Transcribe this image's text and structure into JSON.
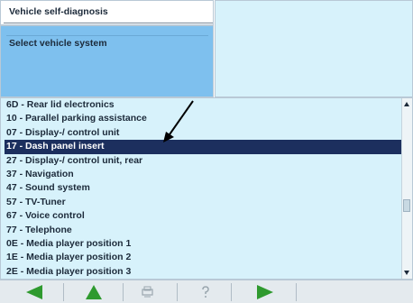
{
  "header": {
    "title": "Vehicle self-diagnosis"
  },
  "prompt": {
    "text": "Select vehicle system"
  },
  "systems": [
    "6D - Rear lid electronics",
    "10 - Parallel parking assistance",
    "07 - Display-/ control unit",
    "17 - Dash panel insert",
    "27 - Display-/ control unit, rear",
    "37 - Navigation",
    "47 - Sound system",
    "57 - TV-Tuner",
    "67 - Voice control",
    "77 - Telephone",
    "0E - Media player position 1",
    "1E - Media player position 2",
    "2E - Media player position 3"
  ],
  "selected_index": 3,
  "toolbar": {
    "buttons": [
      "arrow-left-icon",
      "arrow-up-icon",
      "print-icon",
      "help-icon",
      "arrow-right-icon"
    ]
  },
  "colors": {
    "panel_background": "#d7f2fb",
    "prompt_background": "#7ec0ee",
    "selection": "#1c2f5e",
    "nav_green": "#2f9a2f"
  }
}
